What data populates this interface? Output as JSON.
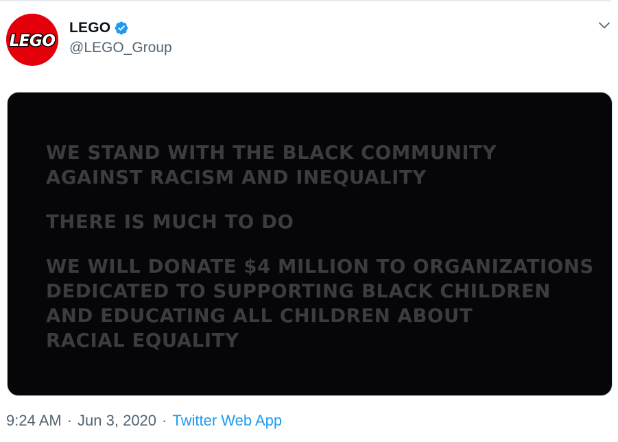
{
  "tweet": {
    "author": {
      "display_name": "LEGO",
      "handle": "@LEGO_Group",
      "logo_text": "LEGO",
      "verified": true
    },
    "image_text": {
      "paragraph_1": "WE STAND WITH THE BLACK COMMUNITY\nAGAINST RACISM AND INEQUALITY",
      "paragraph_2": "THERE IS MUCH TO DO",
      "paragraph_3": "WE WILL DONATE $4 MILLION TO ORGANIZATIONS\nDEDICATED TO SUPPORTING BLACK CHILDREN\nAND EDUCATING ALL CHILDREN ABOUT\nRACIAL EQUALITY"
    },
    "meta": {
      "time": "9:24 AM",
      "separator": "·",
      "date": "Jun 3, 2020",
      "source": "Twitter Web App"
    },
    "icons": {
      "verified": "verified-badge-icon",
      "caret": "chevron-down-icon"
    },
    "colors": {
      "logo_red": "#e3000b",
      "verified_blue": "#1d9bf0",
      "link_blue": "#1d9bf0",
      "card_background": "#060609",
      "card_text": "#3c3c3f"
    }
  }
}
